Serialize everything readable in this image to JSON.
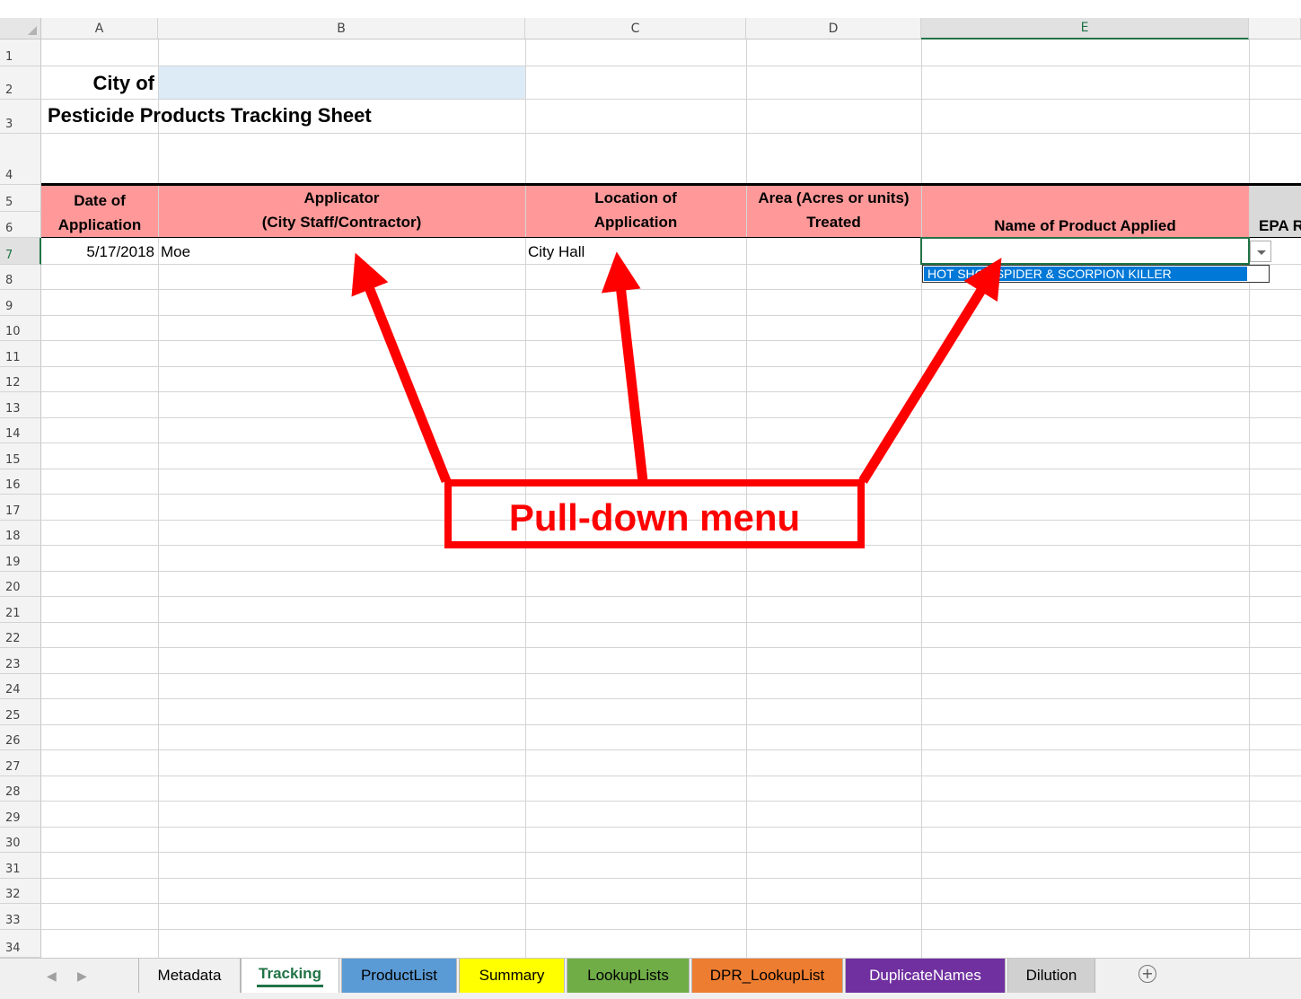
{
  "columns": [
    "A",
    "B",
    "C",
    "D",
    "E"
  ],
  "rows": [
    "1",
    "2",
    "3",
    "4",
    "5",
    "6",
    "7",
    "8",
    "9",
    "10",
    "11",
    "12",
    "13",
    "14",
    "15",
    "16",
    "17",
    "18",
    "19",
    "20",
    "21",
    "22",
    "23",
    "24",
    "25",
    "26",
    "27",
    "28",
    "29",
    "30",
    "31",
    "32",
    "33",
    "34"
  ],
  "sheet": {
    "city_label": "City of",
    "title": "Pesticide Products Tracking Sheet",
    "headers": {
      "date_line1": "Date of",
      "date_line2": "Application",
      "applicator_line1": "Applicator",
      "applicator_line2": "(City Staff/Contractor)",
      "location_line1": "Location of",
      "location_line2": "Application",
      "area_line1": "Area (Acres or units)",
      "area_line2": "Treated",
      "product": "Name of Product Applied",
      "epa_partial": "EPA R"
    },
    "row7": {
      "date": "5/17/2018",
      "applicator": "Moe",
      "location": "City Hall",
      "area": "",
      "product": ""
    },
    "dropdown_option": "HOT SHOT SPIDER & SCORPION KILLER"
  },
  "annotation": {
    "label": "Pull-down menu",
    "color": "#ff0000"
  },
  "tabs": [
    {
      "label": "Metadata",
      "color": "#f0f0f0"
    },
    {
      "label": "Tracking",
      "color": "#ffffff",
      "active": true
    },
    {
      "label": "ProductList",
      "color": "#5b9bd5"
    },
    {
      "label": "Summary",
      "color": "#ffff00"
    },
    {
      "label": "LookupLists",
      "color": "#70ad47"
    },
    {
      "label": "DPR_LookupList",
      "color": "#ed7d31"
    },
    {
      "label": "DuplicateNames",
      "color": "#7030a0"
    },
    {
      "label": "Dilution",
      "color": "#d0d0d0"
    }
  ],
  "colors": {
    "header_fill": "#ff9999",
    "city_input_fill": "#ddebf7",
    "selection_green": "#217346",
    "dropdown_highlight": "#0078d7"
  },
  "icons": [
    "select-all-corner-icon",
    "scroll-left-icon",
    "scroll-right-icon",
    "dropdown-arrow-icon",
    "add-sheet-icon"
  ]
}
